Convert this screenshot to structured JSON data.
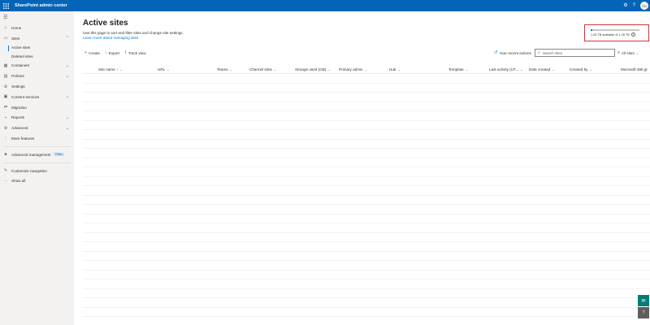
{
  "header": {
    "app_title": "SharePoint admin center",
    "settings_icon": "gear-icon",
    "help_icon": "help-icon",
    "avatar_initials": "TH"
  },
  "sidebar": {
    "items": [
      {
        "label": "Home",
        "icon": "home-icon"
      },
      {
        "label": "Sites",
        "icon": "sites-icon",
        "expanded": true,
        "children": [
          "Active sites",
          "Deleted sites"
        ],
        "active_child": "Active sites"
      },
      {
        "label": "Containers",
        "icon": "containers-icon"
      },
      {
        "label": "Policies",
        "icon": "policies-icon"
      },
      {
        "label": "Settings",
        "icon": "settings-icon"
      },
      {
        "label": "Content services",
        "icon": "content-services-icon"
      },
      {
        "label": "Migration",
        "icon": "migration-icon"
      },
      {
        "label": "Reports",
        "icon": "reports-icon"
      },
      {
        "label": "Advanced",
        "icon": "advanced-icon"
      },
      {
        "label": "More features",
        "icon": "more-features-icon"
      },
      {
        "label": "Advanced management",
        "icon": "advanced-management-icon",
        "badge": "TRIAL"
      },
      {
        "label": "Customize navigation",
        "icon": "edit-icon"
      },
      {
        "label": "Show all",
        "icon": "ellipsis-icon"
      }
    ]
  },
  "page": {
    "title": "Active sites",
    "description": "Use this page to sort and filter sites and change site settings.",
    "learn_more": "Learn more about managing sites"
  },
  "storage": {
    "text": "1.25 TB available of 1.26 TB",
    "used_fraction": 0.01
  },
  "toolbar": {
    "create": "Create",
    "export": "Export",
    "track_view": "Track view",
    "recent_actions": "Your recent actions",
    "search_placeholder": "Search sites",
    "view_filter": "All sites"
  },
  "table": {
    "columns": [
      "Site name ↑",
      "URL",
      "Teams",
      "Channel sites",
      "Storage used (GB)",
      "Primary admin",
      "Hub",
      "Template",
      "Last activity (UT...",
      "Date created",
      "Created by",
      "Microsoft 365 gr"
    ],
    "rows": []
  },
  "colors": {
    "brand": "#0364b8",
    "accent": "#0078d4",
    "highlight_border": "#d13438"
  }
}
